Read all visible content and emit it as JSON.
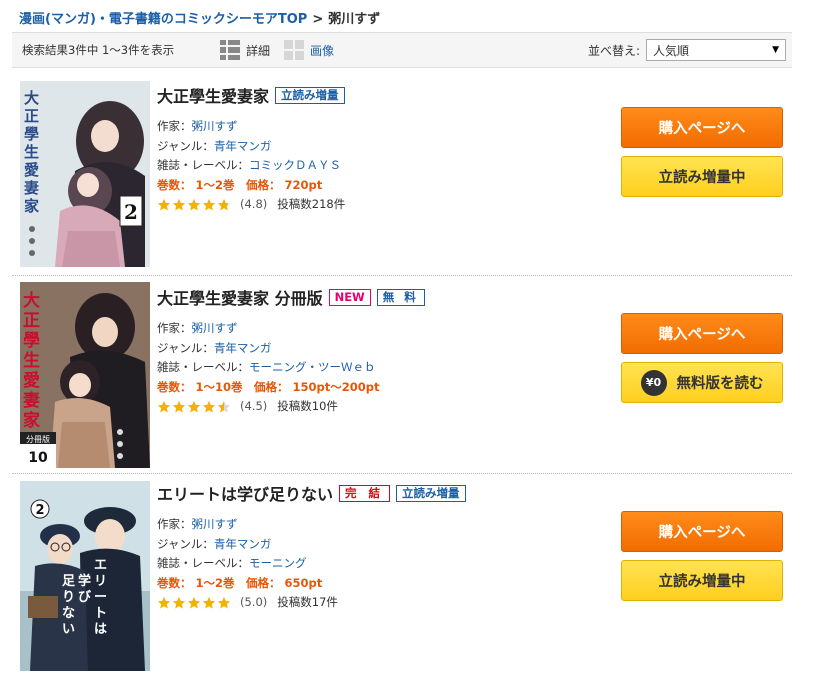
{
  "breadcrumb": {
    "top_link": "漫画(マンガ)・電子書籍のコミックシーモアTOP",
    "separator": ">",
    "current": "粥川すず"
  },
  "toolbar": {
    "result_count": "検索結果3件中 1〜3件を表示",
    "view_detail": "詳細",
    "view_image": "画像",
    "sort_label": "並べ替え:",
    "sort_value": "人気順"
  },
  "labels": {
    "author": "作家：",
    "genre": "ジャンル：",
    "magazine": "雑誌・レーベル：",
    "volumes": "巻数：",
    "price": "価格：",
    "buy_button": "購入ページへ"
  },
  "items": [
    {
      "title": "大正學生愛妻家",
      "tags": [
        "立読み増量"
      ],
      "author": "粥川すず",
      "genre": "青年マンガ",
      "magazine": "コミックＤＡＹＳ",
      "volumes": "1〜2巻",
      "price": "720pt",
      "rating": "(4.8)",
      "rating_value": 4.8,
      "reviews": "投稿数218件",
      "read_button": "立読み増量中",
      "cover_text": "大正學生愛妻家",
      "cover_number": "2"
    },
    {
      "title": "大正學生愛妻家 分冊版",
      "tags": [
        "NEW",
        "無 料"
      ],
      "author": "粥川すず",
      "genre": "青年マンガ",
      "magazine": "モーニング・ツーＷｅｂ",
      "volumes": "1〜10巻",
      "price": "150pt〜200pt",
      "rating": "(4.5)",
      "rating_value": 4.5,
      "reviews": "投稿数10件",
      "read_button": "無料版を読む",
      "free_badge": "¥0",
      "cover_text": "大正學生愛妻家",
      "cover_number": "10",
      "cover_sub": "分冊版"
    },
    {
      "title": "エリートは学び足りない",
      "tags": [
        "完 結",
        "立読み増量"
      ],
      "author": "粥川すず",
      "genre": "青年マンガ",
      "magazine": "モーニング",
      "volumes": "1〜2巻",
      "price": "650pt",
      "rating": "(5.0)",
      "rating_value": 5.0,
      "reviews": "投稿数17件",
      "read_button": "立読み増量中",
      "cover_text": "エリートは学び足りない",
      "cover_number": "2"
    }
  ],
  "colors": {
    "link_blue": "#1a5fa8",
    "price_orange": "#ea5504",
    "buy_orange": "#f7790a",
    "read_yellow": "#ffd93a",
    "new_pink": "#e4006f",
    "complete_red": "#e60012",
    "star_gold": "#f2b300"
  }
}
